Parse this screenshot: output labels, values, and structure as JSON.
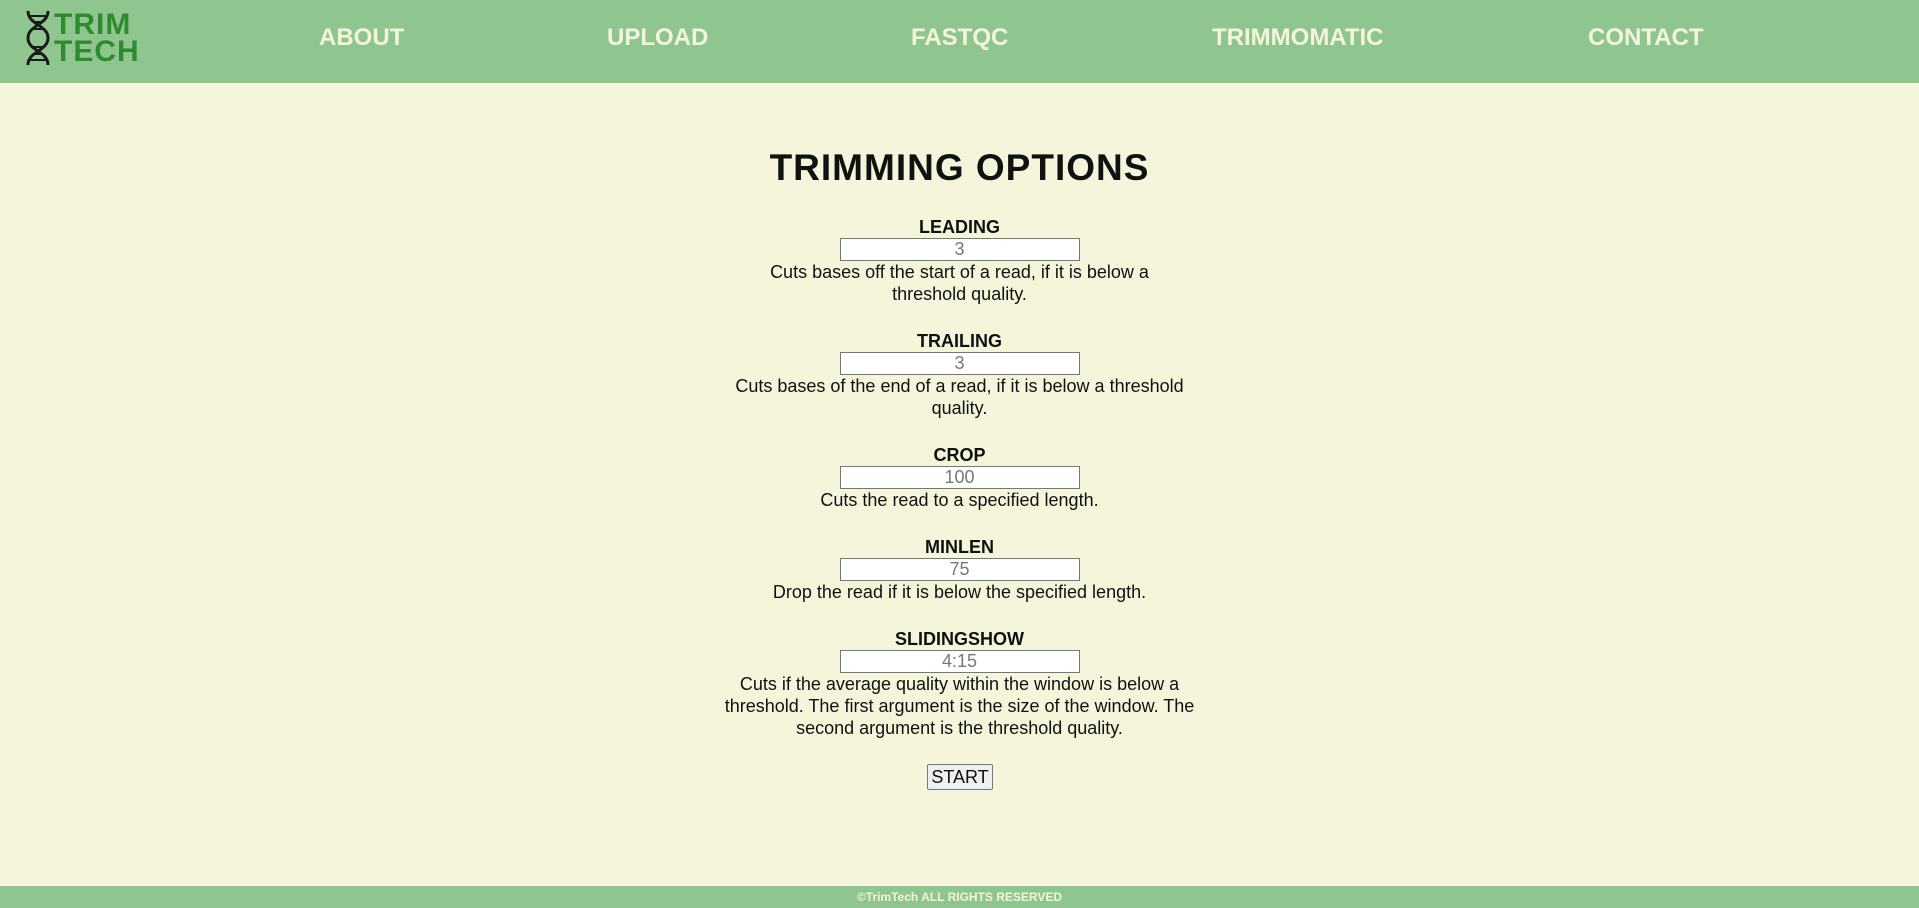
{
  "brand": {
    "logo_line1": "TRIM",
    "logo_line2": "TECH"
  },
  "nav": {
    "items": [
      {
        "label": "ABOUT"
      },
      {
        "label": "UPLOAD"
      },
      {
        "label": "FASTQC"
      },
      {
        "label": "TRIMMOMATIC"
      },
      {
        "label": "CONTACT"
      }
    ]
  },
  "main": {
    "title": "TRIMMING OPTIONS",
    "options": [
      {
        "label": "LEADING",
        "placeholder": "3",
        "description": "Cuts bases off the start of a read, if it is below a threshold quality."
      },
      {
        "label": "TRAILING",
        "placeholder": "3",
        "description": "Cuts bases of the end of a read, if it is below a threshold quality."
      },
      {
        "label": "CROP",
        "placeholder": "100",
        "description": "Cuts the read to a specified length."
      },
      {
        "label": "MINLEN",
        "placeholder": "75",
        "description": "Drop the read if it is below the specified length."
      },
      {
        "label": "SLIDINGSHOW",
        "placeholder": "4:15",
        "description": "Cuts if the average quality within the window is below a threshold. The first argument is the size of the window. The second argument is the threshold quality."
      }
    ],
    "start_label": "START"
  },
  "footer": {
    "text": "©TrimTech ALL RIGHTS RESERVED"
  },
  "colors": {
    "header_bg": "#8fc68f",
    "page_bg": "#f5f5dc",
    "nav_text": "#f5f5dc",
    "logo_green": "#2e8b2e"
  },
  "icons": {
    "logo": "dna-helix-icon"
  }
}
